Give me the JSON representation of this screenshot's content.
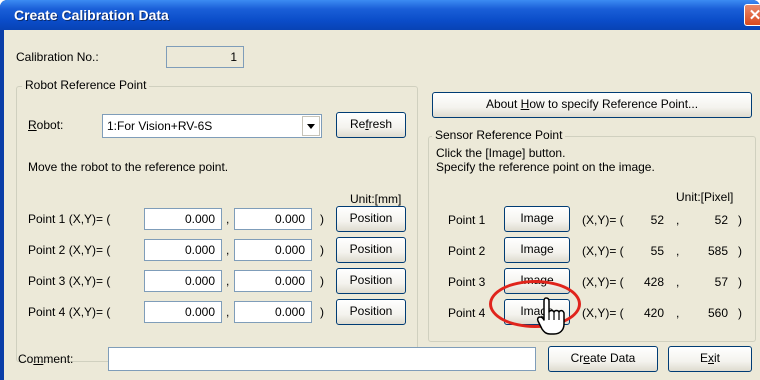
{
  "window": {
    "title": "Create Calibration Data",
    "close_glyph": "✕"
  },
  "calibration": {
    "label": "Calibration No.:",
    "value": "1"
  },
  "robot_group": {
    "title": "Robot Reference Point",
    "robot_label_pre": "",
    "robot_label_u": "R",
    "robot_label_post": "obot:",
    "robot_selected": "1:For Vision+RV-6S",
    "refresh_pre": "Re",
    "refresh_u": "f",
    "refresh_post": "resh",
    "instruction": "Move the robot to the reference point.",
    "unit": "Unit:[mm]",
    "points": [
      {
        "label": "Point 1 (X,Y)= (",
        "x": "0.000",
        "y": "0.000",
        "close": ")",
        "button": "Position"
      },
      {
        "label": "Point 2 (X,Y)= (",
        "x": "0.000",
        "y": "0.000",
        "close": ")",
        "button": "Position"
      },
      {
        "label": "Point 3 (X,Y)= (",
        "x": "0.000",
        "y": "0.000",
        "close": ")",
        "button": "Position"
      },
      {
        "label": "Point 4 (X,Y)= (",
        "x": "0.000",
        "y": "0.000",
        "close": ")",
        "button": "Position"
      }
    ],
    "comma": ","
  },
  "about_button": {
    "pre": "About ",
    "u": "H",
    "post": "ow to specify Reference Point..."
  },
  "sensor_group": {
    "title": "Sensor Reference Point",
    "instruction_1": "Click the [Image] button.",
    "instruction_2": "Specify the reference point on the image.",
    "unit": "Unit:[Pixel]",
    "points": [
      {
        "label": "Point 1",
        "button": "Image",
        "xy_label": "(X,Y)= (",
        "x": "52",
        "sep": ",",
        "y": "52",
        "close": ")"
      },
      {
        "label": "Point 2",
        "button": "Image",
        "xy_label": "(X,Y)= (",
        "x": "55",
        "sep": ",",
        "y": "585",
        "close": ")"
      },
      {
        "label": "Point 3",
        "button": "Image",
        "xy_label": "(X,Y)= (",
        "x": "428",
        "sep": ",",
        "y": "57",
        "close": ")"
      },
      {
        "label": "Point 4",
        "button": "Image",
        "xy_label": "(X,Y)= (",
        "x": "420",
        "sep": ",",
        "y": "560",
        "close": ")"
      }
    ]
  },
  "comment": {
    "pre": "Co",
    "u": "m",
    "post": "ment:",
    "value": ""
  },
  "create_button": {
    "pre": "Cr",
    "u": "e",
    "post": "ate Data"
  },
  "exit_button": {
    "pre": "E",
    "u": "x",
    "post": "it"
  },
  "colors": {
    "title_bar": "#0a4cc8",
    "dialog_bg": "#ece9d8",
    "highlight": "#e0241c"
  },
  "icons": {
    "close": "close-icon",
    "dropdown": "chevron-down-icon",
    "pointer": "hand-cursor-icon"
  }
}
